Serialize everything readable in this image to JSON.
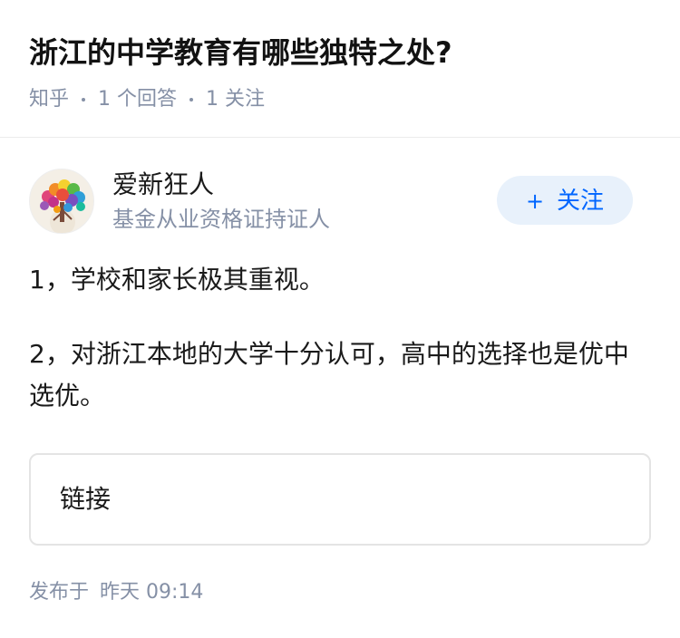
{
  "question": {
    "title": "浙江的中学教育有哪些独特之处?",
    "source": "知乎",
    "answers_count": "1 个回答",
    "followers_count": "1 关注"
  },
  "author": {
    "avatar_icon": "tree-avatar-icon",
    "name": "爱新狂人",
    "description": "基金从业资格证持证人",
    "follow_plus": "+",
    "follow_label": "关注"
  },
  "answer": {
    "paragraphs": [
      "1，学校和家长极其重视。",
      "2，对浙江本地的大学十分认可，高中的选择也是优中选优。"
    ]
  },
  "link_card": {
    "label": "链接"
  },
  "publish": {
    "prefix": "发布于",
    "time": "昨天 09:14"
  },
  "colors": {
    "accent": "#0066ff",
    "accent_bg": "#e8f1fb",
    "muted_text": "#8590a6",
    "title_text": "#121212"
  }
}
